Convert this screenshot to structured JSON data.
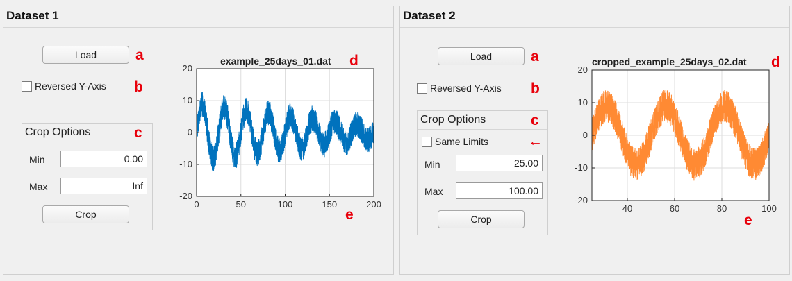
{
  "dataset1": {
    "title": "Dataset 1",
    "load_label": "Load",
    "reversed_label": "Reversed Y-Axis",
    "reversed_checked": false,
    "crop": {
      "title": "Crop Options",
      "min_label": "Min",
      "min_value": "0.00",
      "max_label": "Max",
      "max_value": "Inf",
      "crop_label": "Crop"
    },
    "plot": {
      "title": "example_25days_01.dat",
      "line_color": "#0072bd"
    }
  },
  "dataset2": {
    "title": "Dataset 2",
    "load_label": "Load",
    "reversed_label": "Reversed Y-Axis",
    "reversed_checked": false,
    "crop": {
      "title": "Crop Options",
      "same_limits_label": "Same Limits",
      "same_limits_checked": false,
      "min_label": "Min",
      "min_value": "25.00",
      "max_label": "Max",
      "max_value": "100.00",
      "crop_label": "Crop"
    },
    "plot": {
      "title": "cropped_example_25days_02.dat",
      "line_color": "#ff8a33"
    }
  },
  "markers": {
    "a": "a",
    "b": "b",
    "c": "c",
    "d": "d",
    "e": "e",
    "arrow": "←"
  },
  "chart_data": [
    {
      "type": "line",
      "title": "example_25days_01.dat",
      "xlabel": "",
      "ylabel": "",
      "xlim": [
        0,
        200
      ],
      "ylim": [
        -20,
        20
      ],
      "xticks": [
        0,
        50,
        100,
        150,
        200
      ],
      "yticks": [
        -20,
        -10,
        0,
        10,
        20
      ],
      "grid": true,
      "series": [
        {
          "signal": "damped-oscillation",
          "period": 25,
          "start_amplitude": 9,
          "end_amplitude": 2,
          "noise_amplitude": 4,
          "color": "#0072bd"
        }
      ]
    },
    {
      "type": "line",
      "title": "cropped_example_25days_02.dat",
      "xlabel": "",
      "ylabel": "",
      "xlim": [
        25,
        100
      ],
      "ylim": [
        -20,
        20
      ],
      "xticks": [
        40,
        60,
        80,
        100
      ],
      "yticks": [
        -20,
        -10,
        0,
        10,
        20
      ],
      "grid": true,
      "series": [
        {
          "signal": "oscillation",
          "period": 25,
          "amplitude": 9,
          "noise_amplitude": 5,
          "color": "#ff8a33"
        }
      ]
    }
  ]
}
